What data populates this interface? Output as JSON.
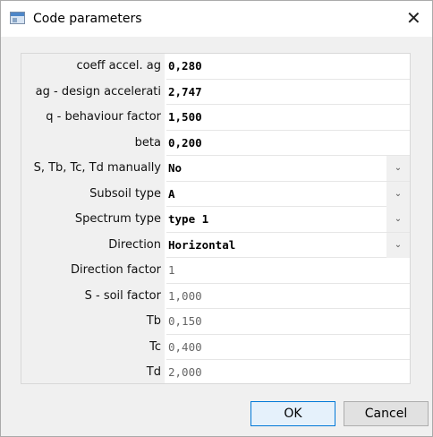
{
  "dialog": {
    "title": "Code parameters",
    "title_icon": "window-icon",
    "close_glyph": "✕"
  },
  "rows": [
    {
      "label": "coeff accel. ag",
      "value": "0,280",
      "kind": "edit"
    },
    {
      "label": "ag - design accelerati",
      "value": "2,747",
      "kind": "edit"
    },
    {
      "label": "q - behaviour factor",
      "value": "1,500",
      "kind": "edit"
    },
    {
      "label": "beta",
      "value": "0,200",
      "kind": "edit"
    },
    {
      "label": "S, Tb, Tc, Td manually",
      "value": "No",
      "kind": "dropdown"
    },
    {
      "label": "Subsoil type",
      "value": "A",
      "kind": "dropdown"
    },
    {
      "label": "Spectrum type",
      "value": "type 1",
      "kind": "dropdown"
    },
    {
      "label": "Direction",
      "value": "Horizontal",
      "kind": "dropdown"
    },
    {
      "label": "Direction factor",
      "value": "1",
      "kind": "readonly"
    },
    {
      "label": "S - soil factor",
      "value": "1,000",
      "kind": "readonly"
    },
    {
      "label": "Tb",
      "value": "0,150",
      "kind": "readonly"
    },
    {
      "label": "Tc",
      "value": "0,400",
      "kind": "readonly"
    },
    {
      "label": "Td",
      "value": "2,000",
      "kind": "readonly"
    }
  ],
  "scrollbar": {
    "up_glyph": "^",
    "down_glyph": "⌄"
  },
  "dropdown_glyph": "⌄",
  "buttons": {
    "ok": "OK",
    "cancel": "Cancel"
  },
  "colors": {
    "accent": "#0078d7",
    "label_bg": "#f0f0f0",
    "readonly_text": "#666666"
  }
}
